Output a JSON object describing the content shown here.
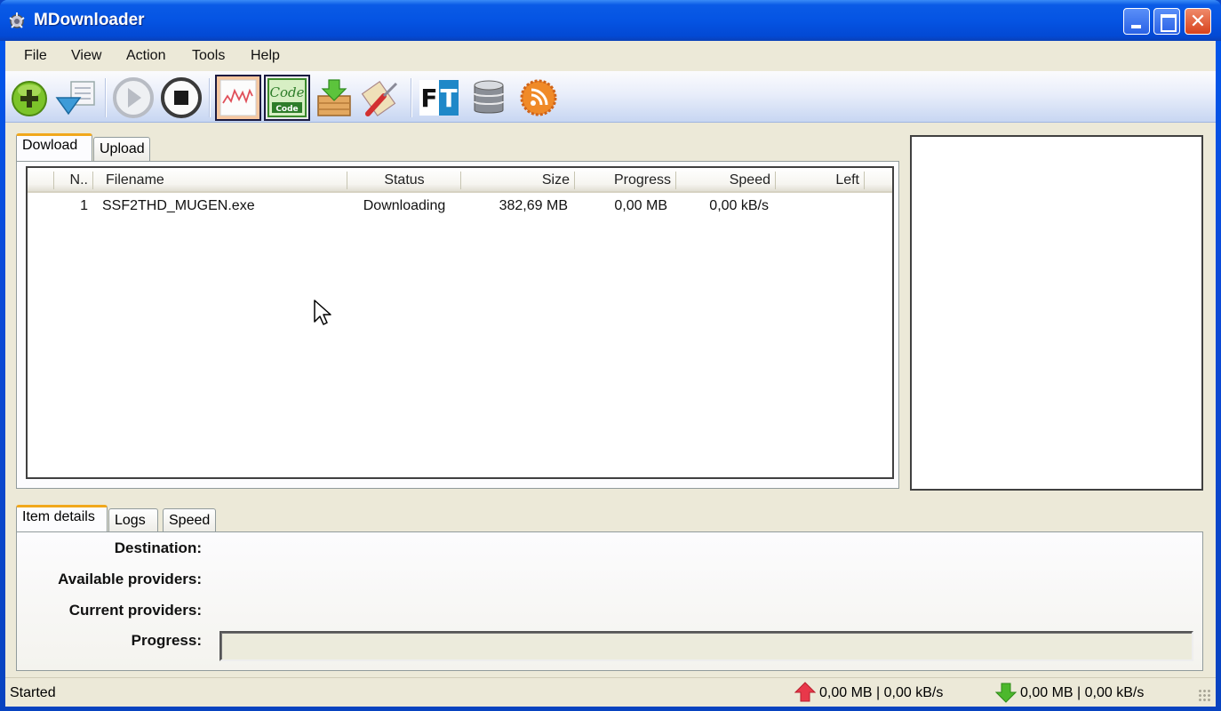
{
  "window": {
    "title": "MDownloader",
    "controls": {
      "minimize": "minimize",
      "maximize": "maximize",
      "close": "✕"
    }
  },
  "menu": [
    "File",
    "View",
    "Action",
    "Tools",
    "Help"
  ],
  "toolbar": {
    "buttons": [
      {
        "name": "add-download",
        "icon": "plus-circle-icon"
      },
      {
        "name": "import-list",
        "icon": "download-list-icon"
      },
      {
        "name": "start",
        "icon": "play-icon",
        "disabled": true
      },
      {
        "name": "stop",
        "icon": "stop-icon"
      },
      {
        "name": "speed-graph",
        "icon": "graph-icon",
        "active": true
      },
      {
        "name": "code",
        "icon": "code-icon",
        "active": true,
        "label": "Code"
      },
      {
        "name": "archive",
        "icon": "box-download-icon"
      },
      {
        "name": "settings",
        "icon": "tools-icon"
      },
      {
        "name": "file-transfer",
        "icon": "ft-icon",
        "letters": [
          "F",
          "T"
        ]
      },
      {
        "name": "database",
        "icon": "database-icon"
      },
      {
        "name": "rss",
        "icon": "rss-icon"
      }
    ]
  },
  "download_tabs": [
    {
      "label": "Dowload",
      "active": true
    },
    {
      "label": "Upload",
      "active": false
    }
  ],
  "table": {
    "columns": [
      "N..",
      "Filename",
      "Status",
      "Size",
      "Progress",
      "Speed",
      "Left"
    ],
    "rows": [
      {
        "n": "1",
        "filename": "SSF2THD_MUGEN.exe",
        "status": "Downloading",
        "size": "382,69 MB",
        "progress": "0,00 MB",
        "speed": "0,00 kB/s",
        "left": ""
      }
    ]
  },
  "details_tabs": [
    {
      "label": "Item details",
      "active": true
    },
    {
      "label": "Logs",
      "active": false
    },
    {
      "label": "Speed",
      "active": false
    }
  ],
  "details": {
    "destination_label": "Destination:",
    "destination_value": "",
    "available_label": "Available providers:",
    "available_value": "",
    "current_label": "Current providers:",
    "current_value": "",
    "progress_label": "Progress:",
    "progress_fraction": 0
  },
  "status": {
    "text": "Started",
    "upload": "0,00 MB | 0,00 kB/s",
    "download": "0,00 MB | 0,00 kB/s"
  },
  "colors": {
    "titlebar": "#0554e3",
    "client_bg": "#ece9d8",
    "active_tab_accent": "#f1a81c",
    "upload_arrow": "#e8384a",
    "download_arrow": "#4cb82c"
  }
}
